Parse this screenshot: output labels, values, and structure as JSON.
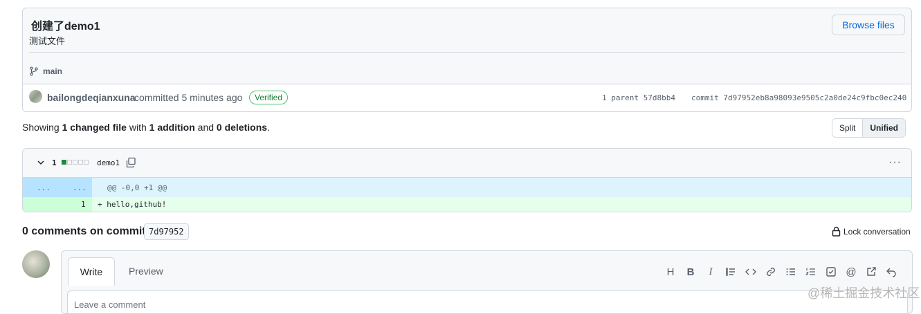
{
  "commit": {
    "title": "创建了demo1",
    "description": "测试文件",
    "browse_label": "Browse files",
    "branch": "main",
    "author": "bailongdeqianxuna",
    "committed_text": "committed 5 minutes ago",
    "verified": "Verified",
    "parent": "1 parent 57d8bb4",
    "commit_sha": "commit 7d97952eb8a98093e9505c2a0de24c9fbc0ec240"
  },
  "summary": {
    "showing": "Showing ",
    "files": "1 changed file",
    "with": " with ",
    "additions": "1 addition",
    "and": " and ",
    "deletions": "0 deletions",
    "end": "."
  },
  "view_toggle": {
    "split": "Split",
    "unified": "Unified"
  },
  "file": {
    "count": "1",
    "name": "demo1",
    "menu": "···",
    "hunk_left": "...",
    "hunk_right": "...",
    "hunk_header": "@@ -0,0 +1 @@",
    "line_number": "1",
    "added_line": "+ hello,github!"
  },
  "comments": {
    "heading": "0 comments on commit",
    "sha": "7d97952",
    "lock": "Lock conversation"
  },
  "editor": {
    "tab_write": "Write",
    "tab_preview": "Preview",
    "placeholder": "Leave a comment",
    "toolbar": [
      "H",
      "B",
      "I",
      "quote",
      "code",
      "link",
      "ul",
      "ol",
      "task",
      "@",
      "ref",
      "undo"
    ]
  },
  "watermark": "@稀土掘金技术社区",
  "colors": {
    "accent": "#0969da",
    "verified": "#1a7f37",
    "add_bg": "#e6ffec",
    "hunk_bg": "#ddf4ff"
  }
}
